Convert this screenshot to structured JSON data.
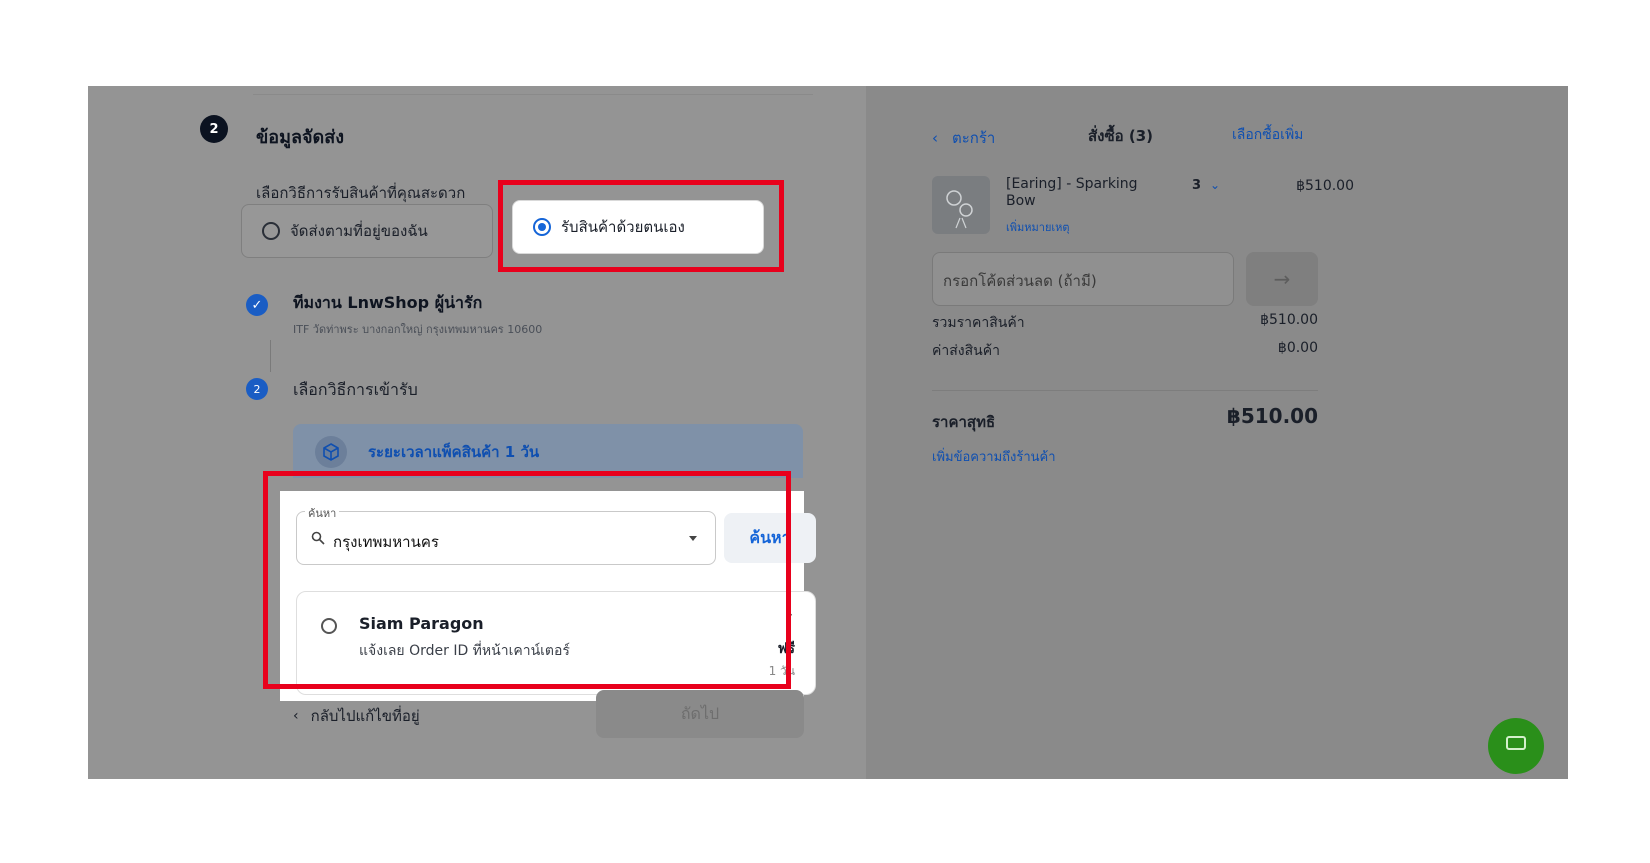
{
  "shipping": {
    "step_number": "2",
    "title": "ข้อมูลจัดส่ง",
    "method_prompt": "เลือกวิธีการรับสินค้าที่คุณสะดวก",
    "option_delivery": "จัดส่งตามที่อยู่ของฉัน",
    "option_pickup": "รับสินค้าด้วยตนเอง",
    "selected_option": "pickup"
  },
  "pickup": {
    "team_title": "ทีมงาน LnwShop ผู้น่ารัก",
    "team_address": "ITF วัดท่าพระ บางกอกใหญ่ กรุงเทพมหานคร 10600",
    "step2_number": "2",
    "step2_label": "เลือกวิธีการเข้ารับ",
    "pack_time": "ระยะเวลาแพ็คสินค้า 1 วัน",
    "search_legend": "ค้นหา",
    "search_value": "กรุงเทพมหานคร",
    "search_button": "ค้นหา",
    "store": {
      "name": "Siam Paragon",
      "description": "แจ้งเลย Order ID ที่หน้าเคาน์เตอร์",
      "marker": "·",
      "price": "ฟรี",
      "days": "1 วัน"
    },
    "back_label": "กลับไปแก้ไขที่อยู่",
    "next_label": "ถัดไป"
  },
  "cart": {
    "back_label": "ตะกร้า",
    "title": "สั่งซื้อ (3)",
    "more_label": "เลือกซื้อเพิ่ม",
    "item": {
      "name": "[Earing] - Sparking Bow",
      "note_link": "เพิ่มหมายเหตุ",
      "quantity": "3",
      "price": "฿510.00"
    },
    "coupon_placeholder": "กรอกโค้ดส่วนลด (ถ้ามี)",
    "subtotal_label": "รวมราคาสินค้า",
    "subtotal_value": "฿510.00",
    "shipping_label": "ค่าส่งสินค้า",
    "shipping_value": "฿0.00",
    "net_label": "ราคาสุทธิ",
    "net_value": "฿510.00",
    "add_message": "เพิ่มข้อความถึงร้านค้า"
  },
  "colors": {
    "highlight": "#e8001c",
    "accent": "#1565d8",
    "chat": "#2a8f1a"
  }
}
